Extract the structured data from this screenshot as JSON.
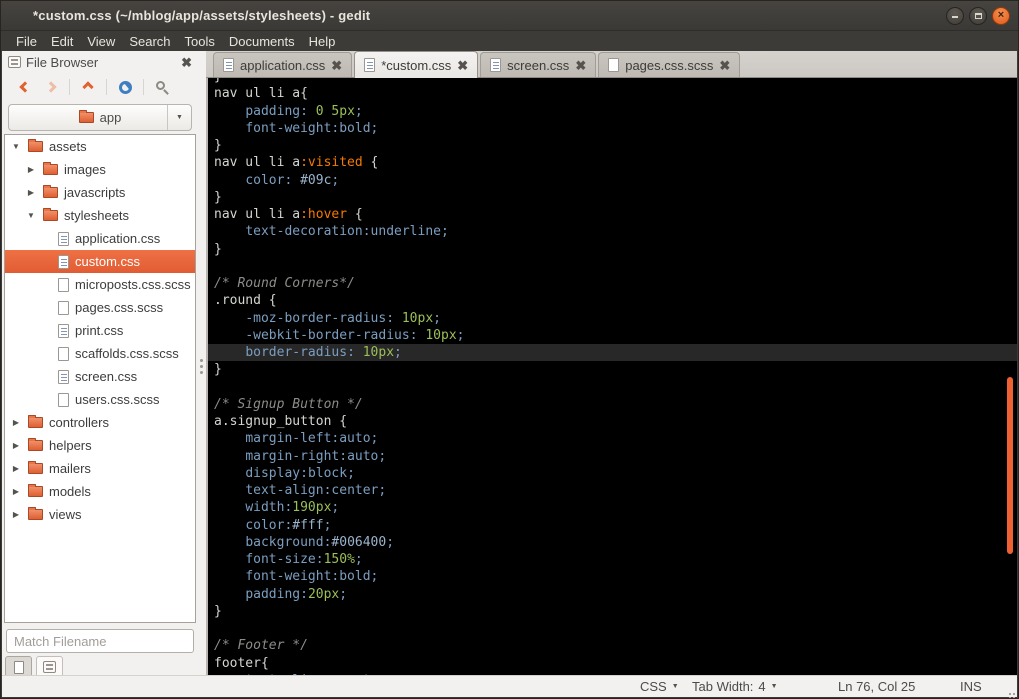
{
  "window": {
    "title": "*custom.css (~/mblog/app/assets/stylesheets) - gedit",
    "controls": [
      "minimize",
      "maximize",
      "close"
    ]
  },
  "menu": {
    "items": [
      "File",
      "Edit",
      "View",
      "Search",
      "Tools",
      "Documents",
      "Help"
    ]
  },
  "sidebar": {
    "header_title": "File Browser",
    "toolbar_icons": [
      "back-icon",
      "forward-icon",
      "up-icon",
      "refresh-icon",
      "search-icon"
    ],
    "location": "app",
    "filter_placeholder": "Match Filename",
    "tree": [
      {
        "label": "assets",
        "icon": "folder",
        "expander": "open",
        "depth": 0
      },
      {
        "label": "images",
        "icon": "folder",
        "expander": "closed",
        "depth": 1
      },
      {
        "label": "javascripts",
        "icon": "folder",
        "expander": "closed",
        "depth": 1
      },
      {
        "label": "stylesheets",
        "icon": "folder",
        "expander": "open",
        "depth": 1
      },
      {
        "label": "application.css",
        "icon": "file-css",
        "expander": "none",
        "depth": 2
      },
      {
        "label": "custom.css",
        "icon": "file-css",
        "expander": "none",
        "depth": 2,
        "selected": true
      },
      {
        "label": "microposts.css.scss",
        "icon": "file-plain",
        "expander": "none",
        "depth": 2
      },
      {
        "label": "pages.css.scss",
        "icon": "file-plain",
        "expander": "none",
        "depth": 2
      },
      {
        "label": "print.css",
        "icon": "file-css",
        "expander": "none",
        "depth": 2
      },
      {
        "label": "scaffolds.css.scss",
        "icon": "file-plain",
        "expander": "none",
        "depth": 2
      },
      {
        "label": "screen.css",
        "icon": "file-css",
        "expander": "none",
        "depth": 2
      },
      {
        "label": "users.css.scss",
        "icon": "file-plain",
        "expander": "none",
        "depth": 2
      },
      {
        "label": "controllers",
        "icon": "folder",
        "expander": "closed",
        "depth": 0
      },
      {
        "label": "helpers",
        "icon": "folder",
        "expander": "closed",
        "depth": 0
      },
      {
        "label": "mailers",
        "icon": "folder",
        "expander": "closed",
        "depth": 0
      },
      {
        "label": "models",
        "icon": "folder",
        "expander": "closed",
        "depth": 0
      },
      {
        "label": "views",
        "icon": "folder",
        "expander": "closed",
        "depth": 0
      }
    ],
    "switcher": [
      "documents-icon",
      "file-browser-icon"
    ]
  },
  "tabs": [
    {
      "label": "application.css",
      "icon": "file-css",
      "active": false
    },
    {
      "label": "*custom.css",
      "icon": "file-css",
      "active": true
    },
    {
      "label": "screen.css",
      "icon": "file-css",
      "active": false
    },
    {
      "label": "pages.css.scss",
      "icon": "file-plain",
      "active": false
    }
  ],
  "editor": {
    "lines": [
      {
        "tokens": [
          [
            "def",
            "}"
          ]
        ]
      },
      {
        "tokens": [
          [
            "def",
            "nav ul li a{"
          ]
        ]
      },
      {
        "tokens": [
          [
            "def",
            "    "
          ],
          [
            "prop",
            "padding"
          ],
          [
            "pun",
            ": "
          ],
          [
            "num",
            "0 5px"
          ],
          [
            "pun",
            ";"
          ]
        ]
      },
      {
        "tokens": [
          [
            "def",
            "    "
          ],
          [
            "prop",
            "font-weight"
          ],
          [
            "pun",
            ":"
          ],
          [
            "kw",
            "bold"
          ],
          [
            "pun",
            ";"
          ]
        ]
      },
      {
        "tokens": [
          [
            "def",
            "}"
          ]
        ]
      },
      {
        "tokens": [
          [
            "def",
            "nav ul li a"
          ],
          [
            "pse",
            ":visited"
          ],
          [
            "def",
            " {"
          ]
        ]
      },
      {
        "tokens": [
          [
            "def",
            "    "
          ],
          [
            "prop",
            "color"
          ],
          [
            "pun",
            ": "
          ],
          [
            "hex",
            "#09c"
          ],
          [
            "pun",
            ";"
          ]
        ]
      },
      {
        "tokens": [
          [
            "def",
            "}"
          ]
        ]
      },
      {
        "tokens": [
          [
            "def",
            "nav ul li a"
          ],
          [
            "pse",
            ":hover"
          ],
          [
            "def",
            " {"
          ]
        ]
      },
      {
        "tokens": [
          [
            "def",
            "    "
          ],
          [
            "prop",
            "text-decoration"
          ],
          [
            "pun",
            ":"
          ],
          [
            "kw",
            "underline"
          ],
          [
            "pun",
            ";"
          ]
        ]
      },
      {
        "tokens": [
          [
            "def",
            "}"
          ]
        ]
      },
      {
        "tokens": []
      },
      {
        "tokens": [
          [
            "com",
            "/* Round Corners*/"
          ]
        ]
      },
      {
        "tokens": [
          [
            "def",
            ".round {"
          ]
        ]
      },
      {
        "tokens": [
          [
            "def",
            "    "
          ],
          [
            "prop",
            "-moz-border-radius"
          ],
          [
            "pun",
            ": "
          ],
          [
            "num",
            "10px"
          ],
          [
            "pun",
            ";"
          ]
        ]
      },
      {
        "tokens": [
          [
            "def",
            "    "
          ],
          [
            "prop",
            "-webkit-border-radius"
          ],
          [
            "pun",
            ": "
          ],
          [
            "num",
            "10px"
          ],
          [
            "pun",
            ";"
          ]
        ]
      },
      {
        "current": true,
        "tokens": [
          [
            "def",
            "    "
          ],
          [
            "prop",
            "border-radius"
          ],
          [
            "pun",
            ": "
          ],
          [
            "num",
            "10px"
          ],
          [
            "pun",
            ";"
          ]
        ]
      },
      {
        "tokens": [
          [
            "def",
            "}"
          ]
        ]
      },
      {
        "tokens": []
      },
      {
        "tokens": [
          [
            "com",
            "/* Signup Button */"
          ]
        ]
      },
      {
        "tokens": [
          [
            "def",
            "a.signup_button {"
          ]
        ]
      },
      {
        "tokens": [
          [
            "def",
            "    "
          ],
          [
            "prop",
            "margin-left"
          ],
          [
            "pun",
            ":"
          ],
          [
            "kw",
            "auto"
          ],
          [
            "pun",
            ";"
          ]
        ]
      },
      {
        "tokens": [
          [
            "def",
            "    "
          ],
          [
            "prop",
            "margin-right"
          ],
          [
            "pun",
            ":"
          ],
          [
            "kw",
            "auto"
          ],
          [
            "pun",
            ";"
          ]
        ]
      },
      {
        "tokens": [
          [
            "def",
            "    "
          ],
          [
            "prop",
            "display"
          ],
          [
            "pun",
            ":"
          ],
          [
            "kw",
            "block"
          ],
          [
            "pun",
            ";"
          ]
        ]
      },
      {
        "tokens": [
          [
            "def",
            "    "
          ],
          [
            "prop",
            "text-align"
          ],
          [
            "pun",
            ":"
          ],
          [
            "kw",
            "center"
          ],
          [
            "pun",
            ";"
          ]
        ]
      },
      {
        "tokens": [
          [
            "def",
            "    "
          ],
          [
            "prop",
            "width"
          ],
          [
            "pun",
            ":"
          ],
          [
            "num",
            "190px"
          ],
          [
            "pun",
            ";"
          ]
        ]
      },
      {
        "tokens": [
          [
            "def",
            "    "
          ],
          [
            "prop",
            "color"
          ],
          [
            "pun",
            ":"
          ],
          [
            "hex",
            "#fff"
          ],
          [
            "pun",
            ";"
          ]
        ]
      },
      {
        "tokens": [
          [
            "def",
            "    "
          ],
          [
            "prop",
            "background"
          ],
          [
            "pun",
            ":"
          ],
          [
            "hex",
            "#006400"
          ],
          [
            "pun",
            ";"
          ]
        ]
      },
      {
        "tokens": [
          [
            "def",
            "    "
          ],
          [
            "prop",
            "font-size"
          ],
          [
            "pun",
            ":"
          ],
          [
            "num",
            "150%"
          ],
          [
            "pun",
            ";"
          ]
        ]
      },
      {
        "tokens": [
          [
            "def",
            "    "
          ],
          [
            "prop",
            "font-weight"
          ],
          [
            "pun",
            ":"
          ],
          [
            "kw",
            "bold"
          ],
          [
            "pun",
            ";"
          ]
        ]
      },
      {
        "tokens": [
          [
            "def",
            "    "
          ],
          [
            "prop",
            "padding"
          ],
          [
            "pun",
            ":"
          ],
          [
            "num",
            "20px"
          ],
          [
            "pun",
            ";"
          ]
        ]
      },
      {
        "tokens": [
          [
            "def",
            "}"
          ]
        ]
      },
      {
        "tokens": []
      },
      {
        "tokens": [
          [
            "com",
            "/* Footer */"
          ]
        ]
      },
      {
        "tokens": [
          [
            "def",
            "footer{"
          ]
        ]
      },
      {
        "tokens": [
          [
            "def",
            "    "
          ],
          [
            "prop",
            "text-align"
          ],
          [
            "pun",
            ": "
          ],
          [
            "kw",
            "center"
          ],
          [
            "pun",
            ";"
          ]
        ]
      }
    ]
  },
  "statusbar": {
    "language": "CSS",
    "tab_width_label": "Tab Width:",
    "tab_width_value": "4",
    "cursor_position": "Ln 76, Col 25",
    "input_mode": "INS"
  },
  "colors": {
    "accent_orange": "#e8603c",
    "editor_background": "#000000",
    "current_line": "#282828",
    "property_blue": "#7b9ec0",
    "number_green": "#9cbf58",
    "pseudo_orange": "#f57900",
    "comment_gray": "#8b8d88",
    "hex_value_blue": "#9ab4cd",
    "default_text": "#d3d7cf",
    "scrollbar_orange": "#ef6132"
  }
}
